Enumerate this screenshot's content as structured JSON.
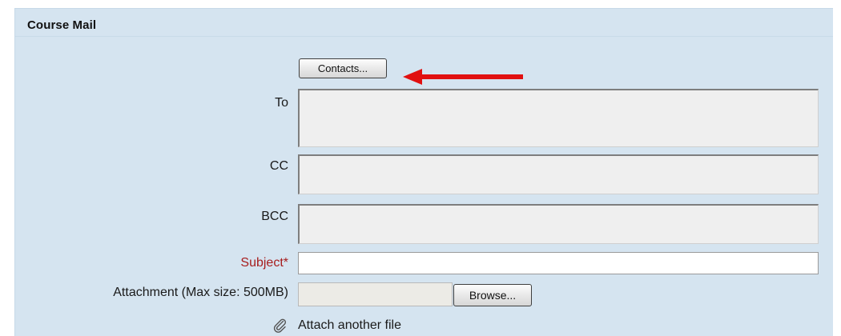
{
  "form": {
    "title": "Course Mail",
    "contacts_button": "Contacts...",
    "fields": {
      "to_label": "To",
      "cc_label": "CC",
      "bcc_label": "BCC",
      "subject_label": "Subject*",
      "attachment_label": "Attachment (Max size: 500MB)"
    },
    "browse_button": "Browse...",
    "attach_another": "Attach another file"
  },
  "colors": {
    "panel_bg": "#d5e4f0",
    "required_label": "#a71d1d",
    "annotation_arrow": "#e11010"
  },
  "icons": {
    "annotation": "red-arrow-left",
    "attach": "paperclip-icon"
  }
}
